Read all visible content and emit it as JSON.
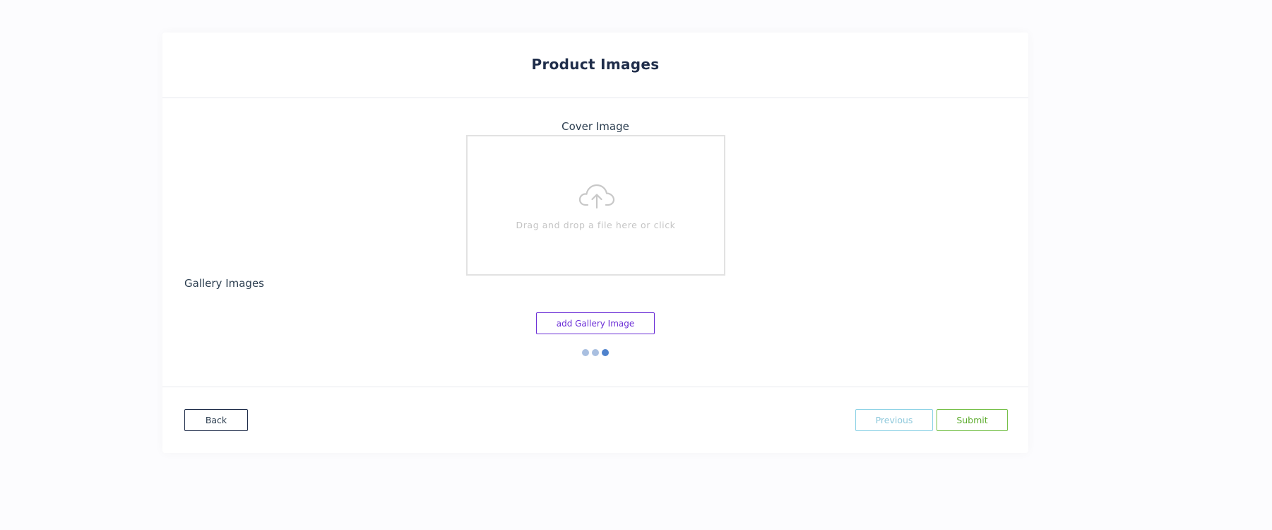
{
  "header": {
    "title": "Product Images"
  },
  "cover": {
    "label": "Cover Image",
    "dropzone_message": "Drag and drop a file here or click",
    "icon": "cloud-upload-icon"
  },
  "gallery": {
    "label": "Gallery Images",
    "add_button_label": "add Gallery Image",
    "loader": {
      "dots": 3,
      "active_dot": 3
    }
  },
  "footer": {
    "back_label": "Back",
    "previous_label": "Previous",
    "submit_label": "Submit"
  },
  "colors": {
    "accent_purple": "#6b2ed6",
    "previous_cyan": "#8fd3e6",
    "submit_green": "#77c04a",
    "loader_dot": "#a9bfe0",
    "loader_dot_active": "#4f82cc",
    "icon_gray": "#c8c8c8"
  }
}
